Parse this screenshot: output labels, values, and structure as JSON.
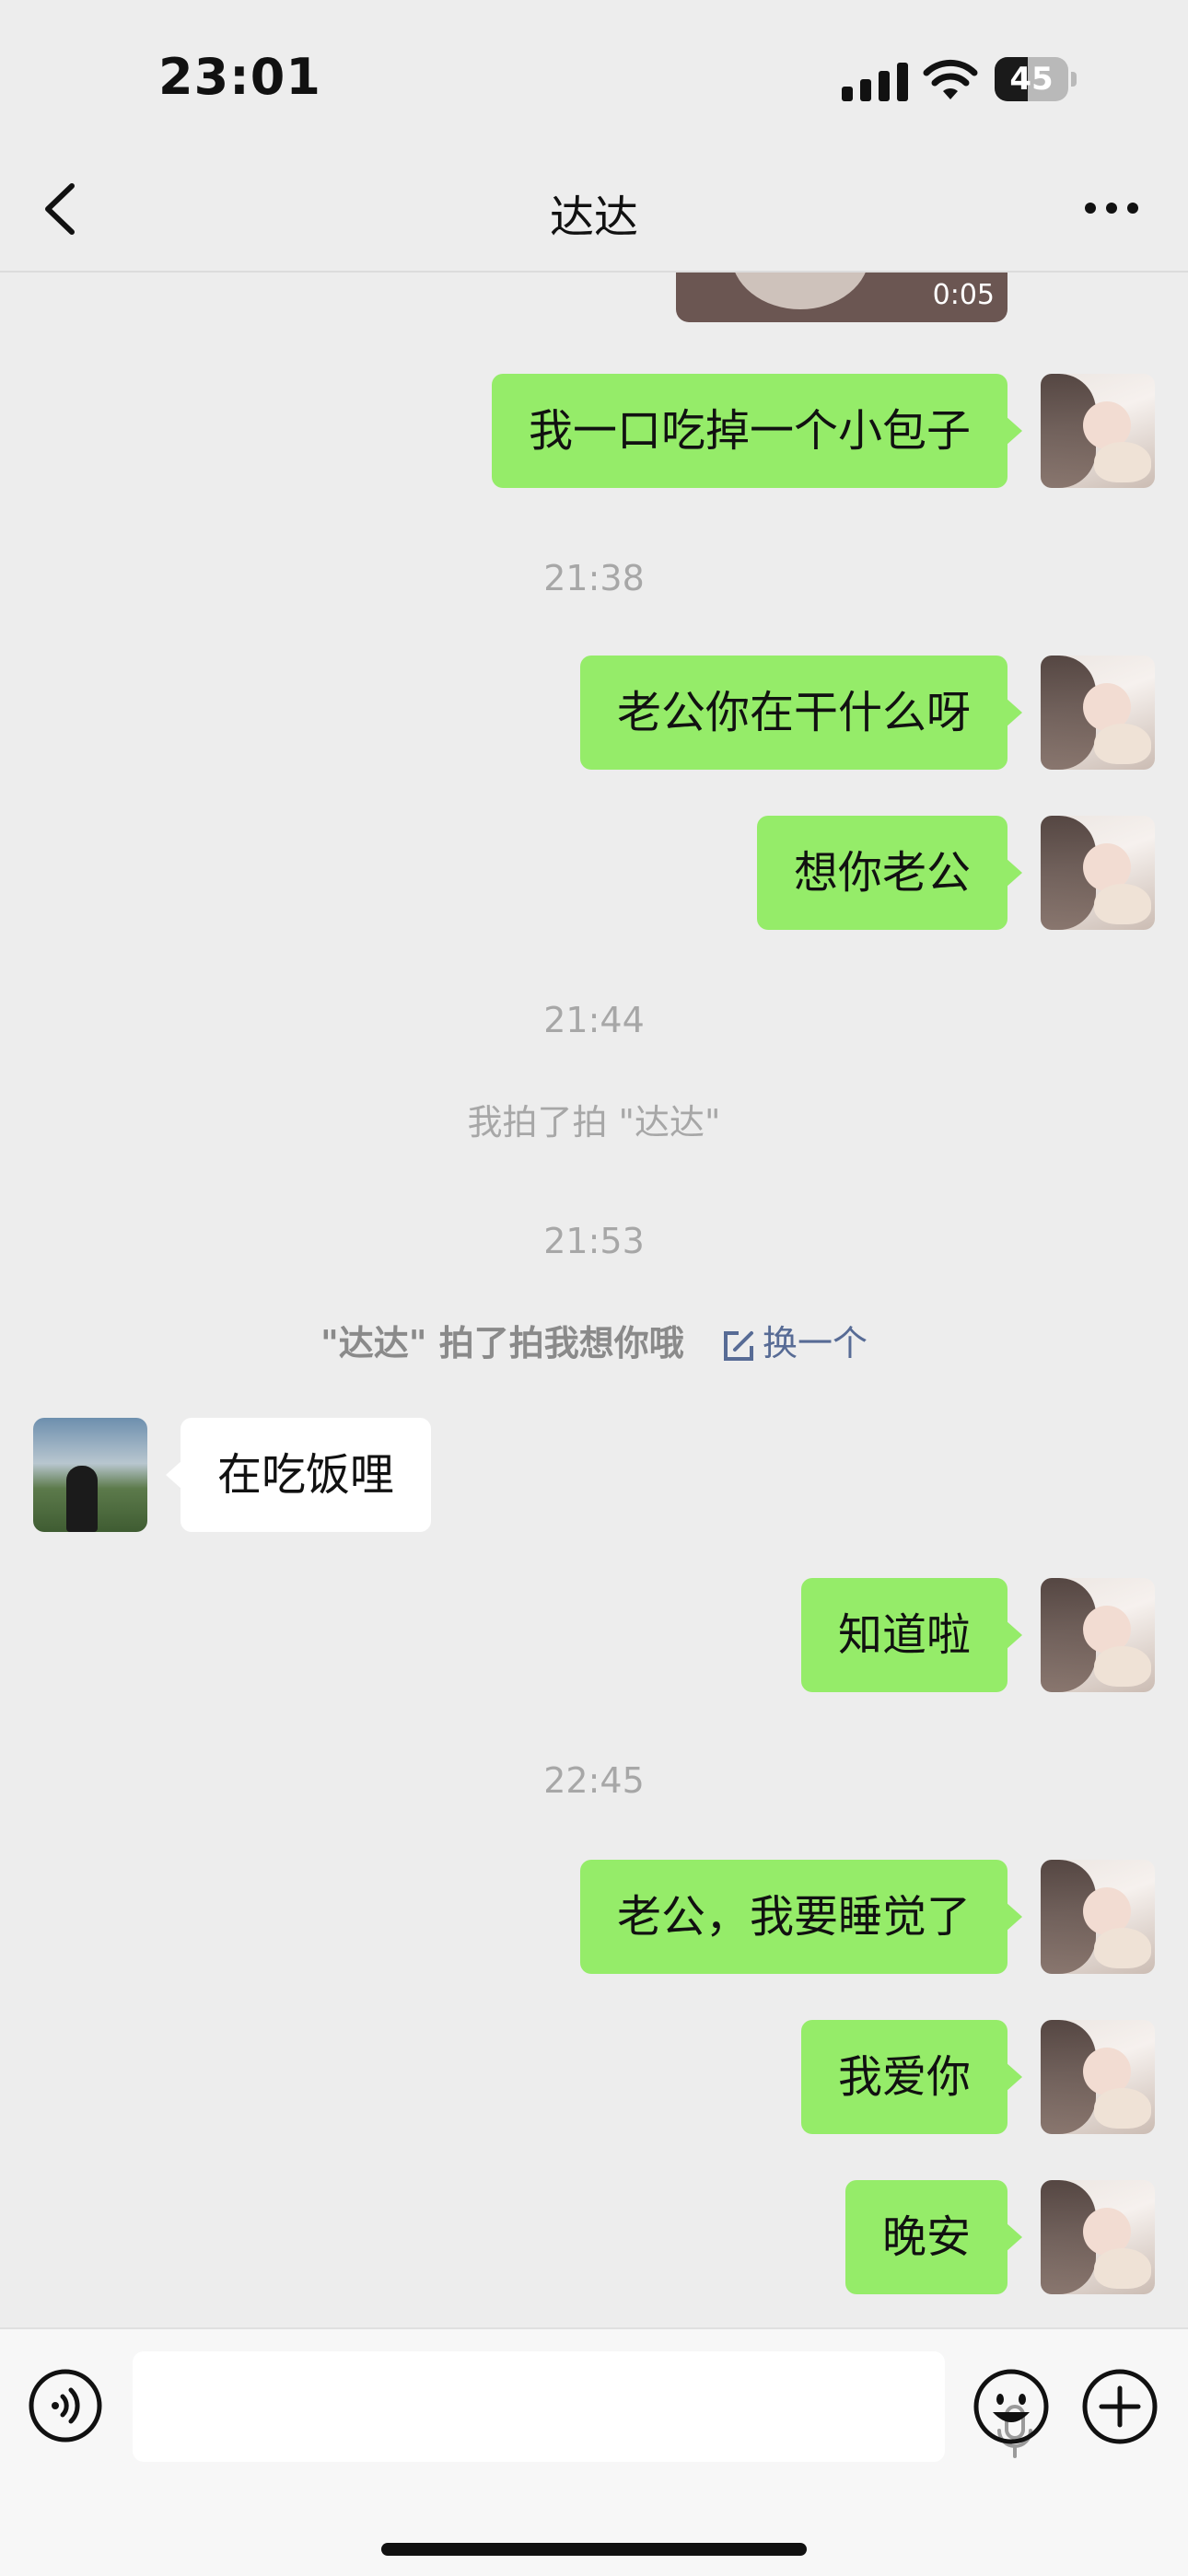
{
  "status_bar": {
    "time": "23:01",
    "battery": "45",
    "battery_level": 0.45
  },
  "navbar": {
    "title": "达达",
    "back_icon": "chevron-left-icon",
    "more_icon": "more-icon"
  },
  "video": {
    "duration": "0:05"
  },
  "messages": [
    {
      "text": "我一口吃掉一个小包子"
    },
    {
      "time": "21:38"
    },
    {
      "text": "老公你在干什么呀"
    },
    {
      "text": "想你老公"
    },
    {
      "time": "21:44"
    },
    {
      "system": "我拍了拍 \"达达\""
    },
    {
      "time": "21:53"
    },
    {
      "pat_text": "\"达达\" 拍了拍我想你哦",
      "pat_action": "换一个"
    },
    {
      "text": "在吃饭哩"
    },
    {
      "text": "知道啦"
    },
    {
      "time": "22:45"
    },
    {
      "text": "老公，我要睡觉了"
    },
    {
      "text": "我爱你"
    },
    {
      "text": "晚安"
    }
  ],
  "input_bar": {
    "voice_icon": "voice-icon",
    "mic_icon": "mic-icon",
    "emoji_icon": "emoji-icon",
    "plus_icon": "plus-icon"
  },
  "colors": {
    "bubble_me": "#95ec69",
    "bubble_other": "#ffffff",
    "background": "#ededed",
    "link": "#576b95"
  }
}
